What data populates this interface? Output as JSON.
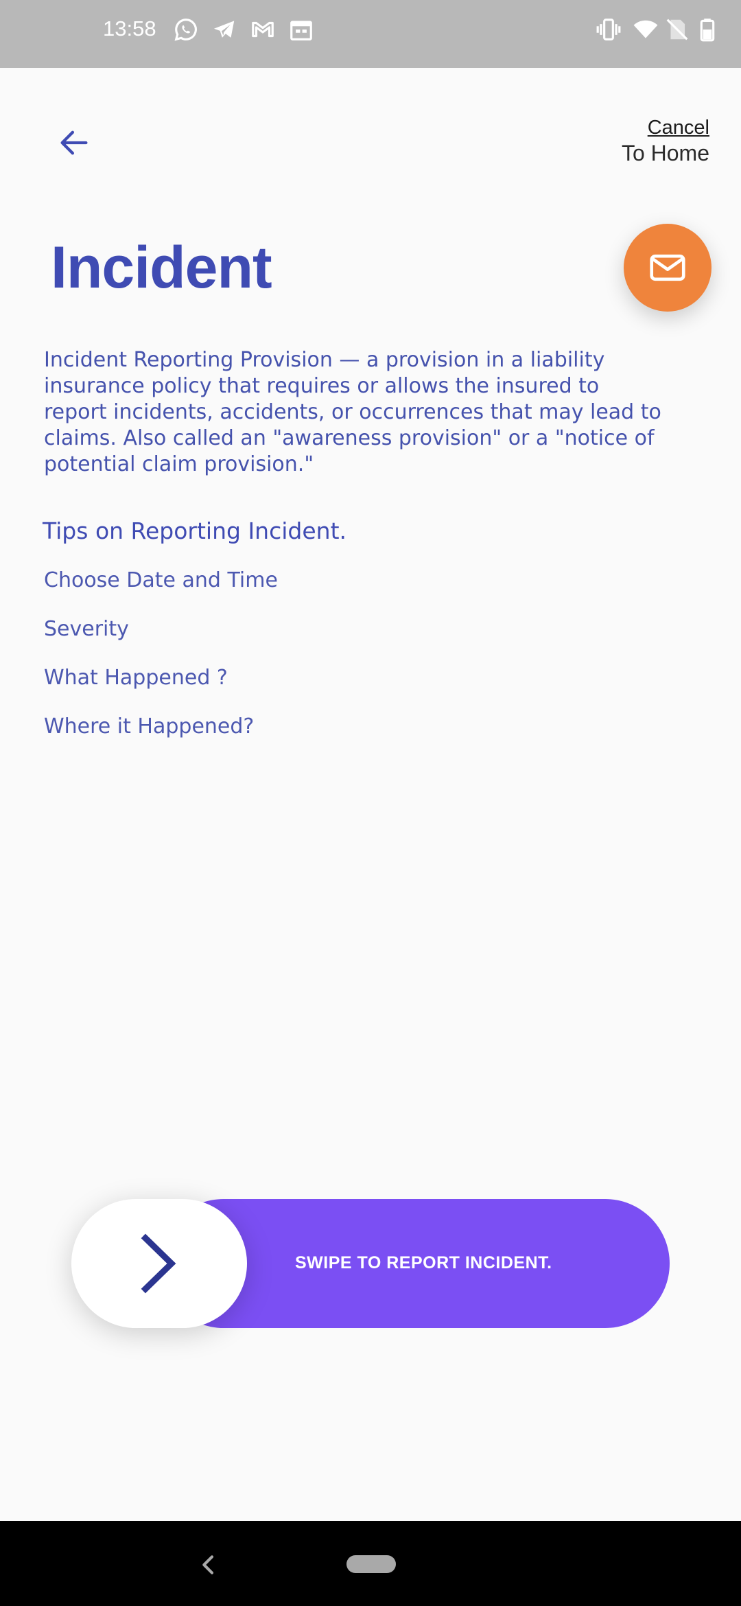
{
  "status_bar": {
    "time": "13:58",
    "left_icons": [
      "whatsapp-icon",
      "telegram-icon",
      "gmail-icon",
      "calendar-icon"
    ],
    "right_icons": [
      "vibrate-icon",
      "wifi-icon",
      "no-sim-icon",
      "battery-icon"
    ]
  },
  "header": {
    "back_icon": "arrow-left-icon",
    "cancel_label": "Cancel",
    "to_home_label": "To Home"
  },
  "page": {
    "title": "Incident",
    "mail_icon": "mail-icon",
    "description": "Incident Reporting Provision — a provision in a liability insurance policy that requires or allows the insured to report incidents, accidents, or occurrences that may lead to claims. Also called an \"awareness provision\" or a \"notice of potential claim provision.\"",
    "tips_heading": "Tips on Reporting Incident.",
    "tips": [
      "Choose Date and Time",
      "Severity",
      "What Happened ?",
      "Where it Happened?"
    ]
  },
  "swipe": {
    "label": "SWIPE TO REPORT INCIDENT.",
    "handle_icon": "chevron-right-icon"
  },
  "nav_bar": {
    "back_icon": "nav-back-icon",
    "home_icon": "home-pill-icon"
  },
  "colors": {
    "primary": "#3f4bb3",
    "accent_orange": "#ef843c",
    "swipe_purple": "#7b4ff3",
    "background": "#fafafa"
  }
}
